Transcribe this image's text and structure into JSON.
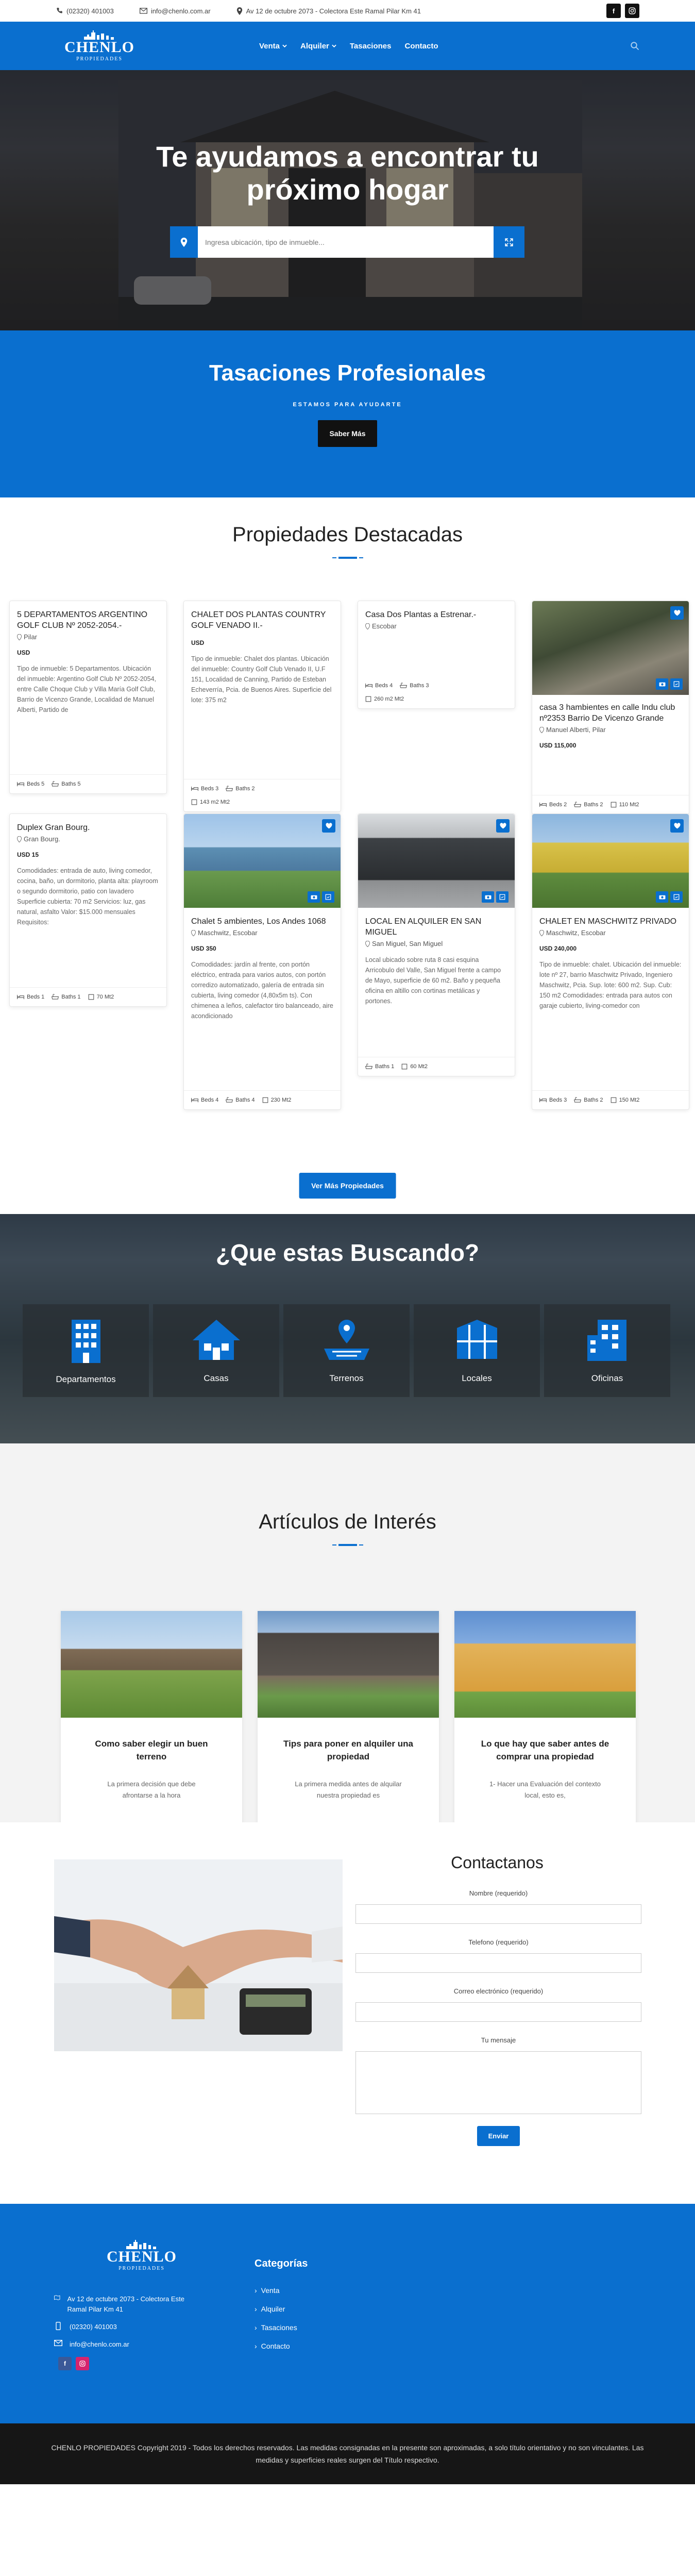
{
  "topbar": {
    "phone": "(02320) 401003",
    "email": "info@chenlo.com.ar",
    "address": "Av 12 de octubre 2073 - Colectora Este Ramal Pilar Km 41",
    "facebook": "f"
  },
  "brand": {
    "name": "CHENLO",
    "sub": "PROPIEDADES"
  },
  "nav": {
    "items": [
      {
        "label": "Venta"
      },
      {
        "label": "Alquiler"
      },
      {
        "label": "Tasaciones"
      },
      {
        "label": "Contacto"
      }
    ]
  },
  "hero": {
    "title_line1": "Te ayudamos a encontrar tu",
    "title_line2": "próximo hogar",
    "search_placeholder": "Ingresa ubicación, tipo de inmueble..."
  },
  "tasaciones": {
    "title": "Tasaciones Profesionales",
    "kicker": "ESTAMOS PARA AYUDARTE",
    "button": "Saber Más"
  },
  "featured": {
    "title": "Propiedades Destacadas",
    "button": "Ver Más Propiedades",
    "cards": [
      {
        "title": "5 DEPARTAMENTOS ARGENTINO GOLF CLUB Nº 2052-2054.-",
        "location": "Pilar",
        "price": "USD",
        "desc": "Tipo de inmueble: 5 Departamentos. Ubicación del inmueble: Argentino Golf Club Nº 2052-2054, entre Calle Choque Club y Villa María Golf Club, Barrio de Vicenzo Grande, Localidad de Manuel Alberti, Partido de",
        "f1": "Beds 5",
        "f2": "Baths 5",
        "f3": ""
      },
      {
        "title": "CHALET DOS PLANTAS COUNTRY GOLF VENADO II.-",
        "location": "",
        "price": "USD",
        "desc": "Tipo de inmueble: Chalet dos plantas. Ubicación del inmueble: Country Golf Club Venado II, U.F 151, Localidad de Canning, Partido de Esteban Echeverría, Pcia. de Buenos Aires. Superficie del lote: 375 m2",
        "f1": "Beds 3",
        "f2": "Baths 2",
        "f3": "143 m2 Mt2"
      },
      {
        "title": "Casa Dos Plantas a Estrenar.-",
        "location": "Escobar",
        "price": "",
        "desc": "",
        "f1": "Beds 4",
        "f2": "Baths 3",
        "f3": "260 m2 Mt2"
      },
      {
        "title": "casa 3 hambientes en calle Indu club nº2353 Barrio De Vicenzo Grande",
        "location": "Manuel Alberti, Pilar",
        "price": "USD 115,000",
        "desc": "",
        "f1": "Beds 2",
        "f2": "Baths 2",
        "f3": "110 Mt2"
      },
      {
        "title": "Duplex Gran Bourg.",
        "location": "Gran Bourg.",
        "price": "USD 15",
        "desc": "Comodidades: entrada de auto, living comedor, cocina, baño, un dormitorio, planta alta: playroom o segundo dormitorio, patio con lavadero Superficie cubierta: 70 m2 Servicios: luz, gas natural, asfalto Valor: $15.000 mensuales Requisitos:",
        "f1": "Beds 1",
        "f2": "Baths 1",
        "f3": "70 Mt2"
      },
      {
        "title": "Chalet 5 ambientes, Los Andes 1068",
        "location": "Maschwitz, Escobar",
        "price": "USD 350",
        "desc": "Comodidades: jardín al frente, con portón eléctrico, entrada para varios autos, con portón corredizo automatizado, galería de entrada sin cubierta, living comedor (4,80x5m ts). Con chimenea a leños, calefactor tiro balanceado, aire acondicionado",
        "f1": "Beds 4",
        "f2": "Baths 4",
        "f3": "230 Mt2"
      },
      {
        "title": "LOCAL EN ALQUILER EN SAN MIGUEL",
        "location": "San Miguel, San Miguel",
        "price": "",
        "desc": "Local ubicado sobre ruta 8 casi esquina Arricobulo del Valle, San Miguel frente a campo de Mayo, superficie de 60 m2. Baño y pequeña oficina en altillo con cortinas metálicas y portones.",
        "f1": "Baths 1",
        "f2": "60 Mt2",
        "f3": ""
      },
      {
        "title": "CHALET EN MASCHWITZ PRIVADO",
        "location": "Maschwitz, Escobar",
        "price": "USD 240,000",
        "desc": "Tipo de inmueble: chalet. Ubicación del inmueble: lote nº 27, barrio Maschwitz Privado, Ingeniero Maschwitz, Pcia. Sup. lote: 600 m2. Sup. Cub: 150 m2 Comodidades: entrada para autos con garaje cubierto, living-comedor con",
        "f1": "Beds 3",
        "f2": "Baths 2",
        "f3": "150 Mt2"
      }
    ]
  },
  "buscando": {
    "title": "¿Que estas Buscando?",
    "items": [
      {
        "label": "Departamentos",
        "icon": "building-icon"
      },
      {
        "label": "Casas",
        "icon": "house-icon"
      },
      {
        "label": "Terrenos",
        "icon": "land-icon"
      },
      {
        "label": "Locales",
        "icon": "store-icon"
      },
      {
        "label": "Oficinas",
        "icon": "office-icon"
      }
    ]
  },
  "articles": {
    "title": "Artículos de Interés",
    "items": [
      {
        "title": "Como saber elegir un buen terreno",
        "excerpt": "La primera decisión que debe afrontarse a la hora"
      },
      {
        "title": "Tips para poner en alquiler una propiedad",
        "excerpt": "La primera medida antes de alquilar nuestra propiedad es"
      },
      {
        "title": "Lo que hay que saber antes de comprar una propiedad",
        "excerpt": "1- Hacer una Evaluación del contexto local, esto es,"
      }
    ]
  },
  "contact": {
    "title": "Contactanos",
    "name_label": "Nombre (requerido)",
    "phone_label": "Telefono (requerido)",
    "email_label": "Correo electrónico (requerido)",
    "message_label": "Tu mensaje",
    "send": "Enviar"
  },
  "footer": {
    "address": "Av 12 de octubre 2073 - Colectora Este Ramal Pilar Km 41",
    "phone": "(02320) 401003",
    "email": "info@chenlo.com.ar",
    "categories_title": "Categorías",
    "categories": [
      "Venta",
      "Alquiler",
      "Tasaciones",
      "Contacto"
    ],
    "copyright": "CHENLO PROPIEDADES Copyright 2019 - Todos los derechos reservados. Las medidas consignadas en la presente son aproximadas, a solo título orientativo y no son vinculantes. Las medidas y superficies reales surgen del Título respectivo."
  },
  "colors": {
    "brand_blue": "#0a6fcf",
    "dark": "#161616"
  }
}
